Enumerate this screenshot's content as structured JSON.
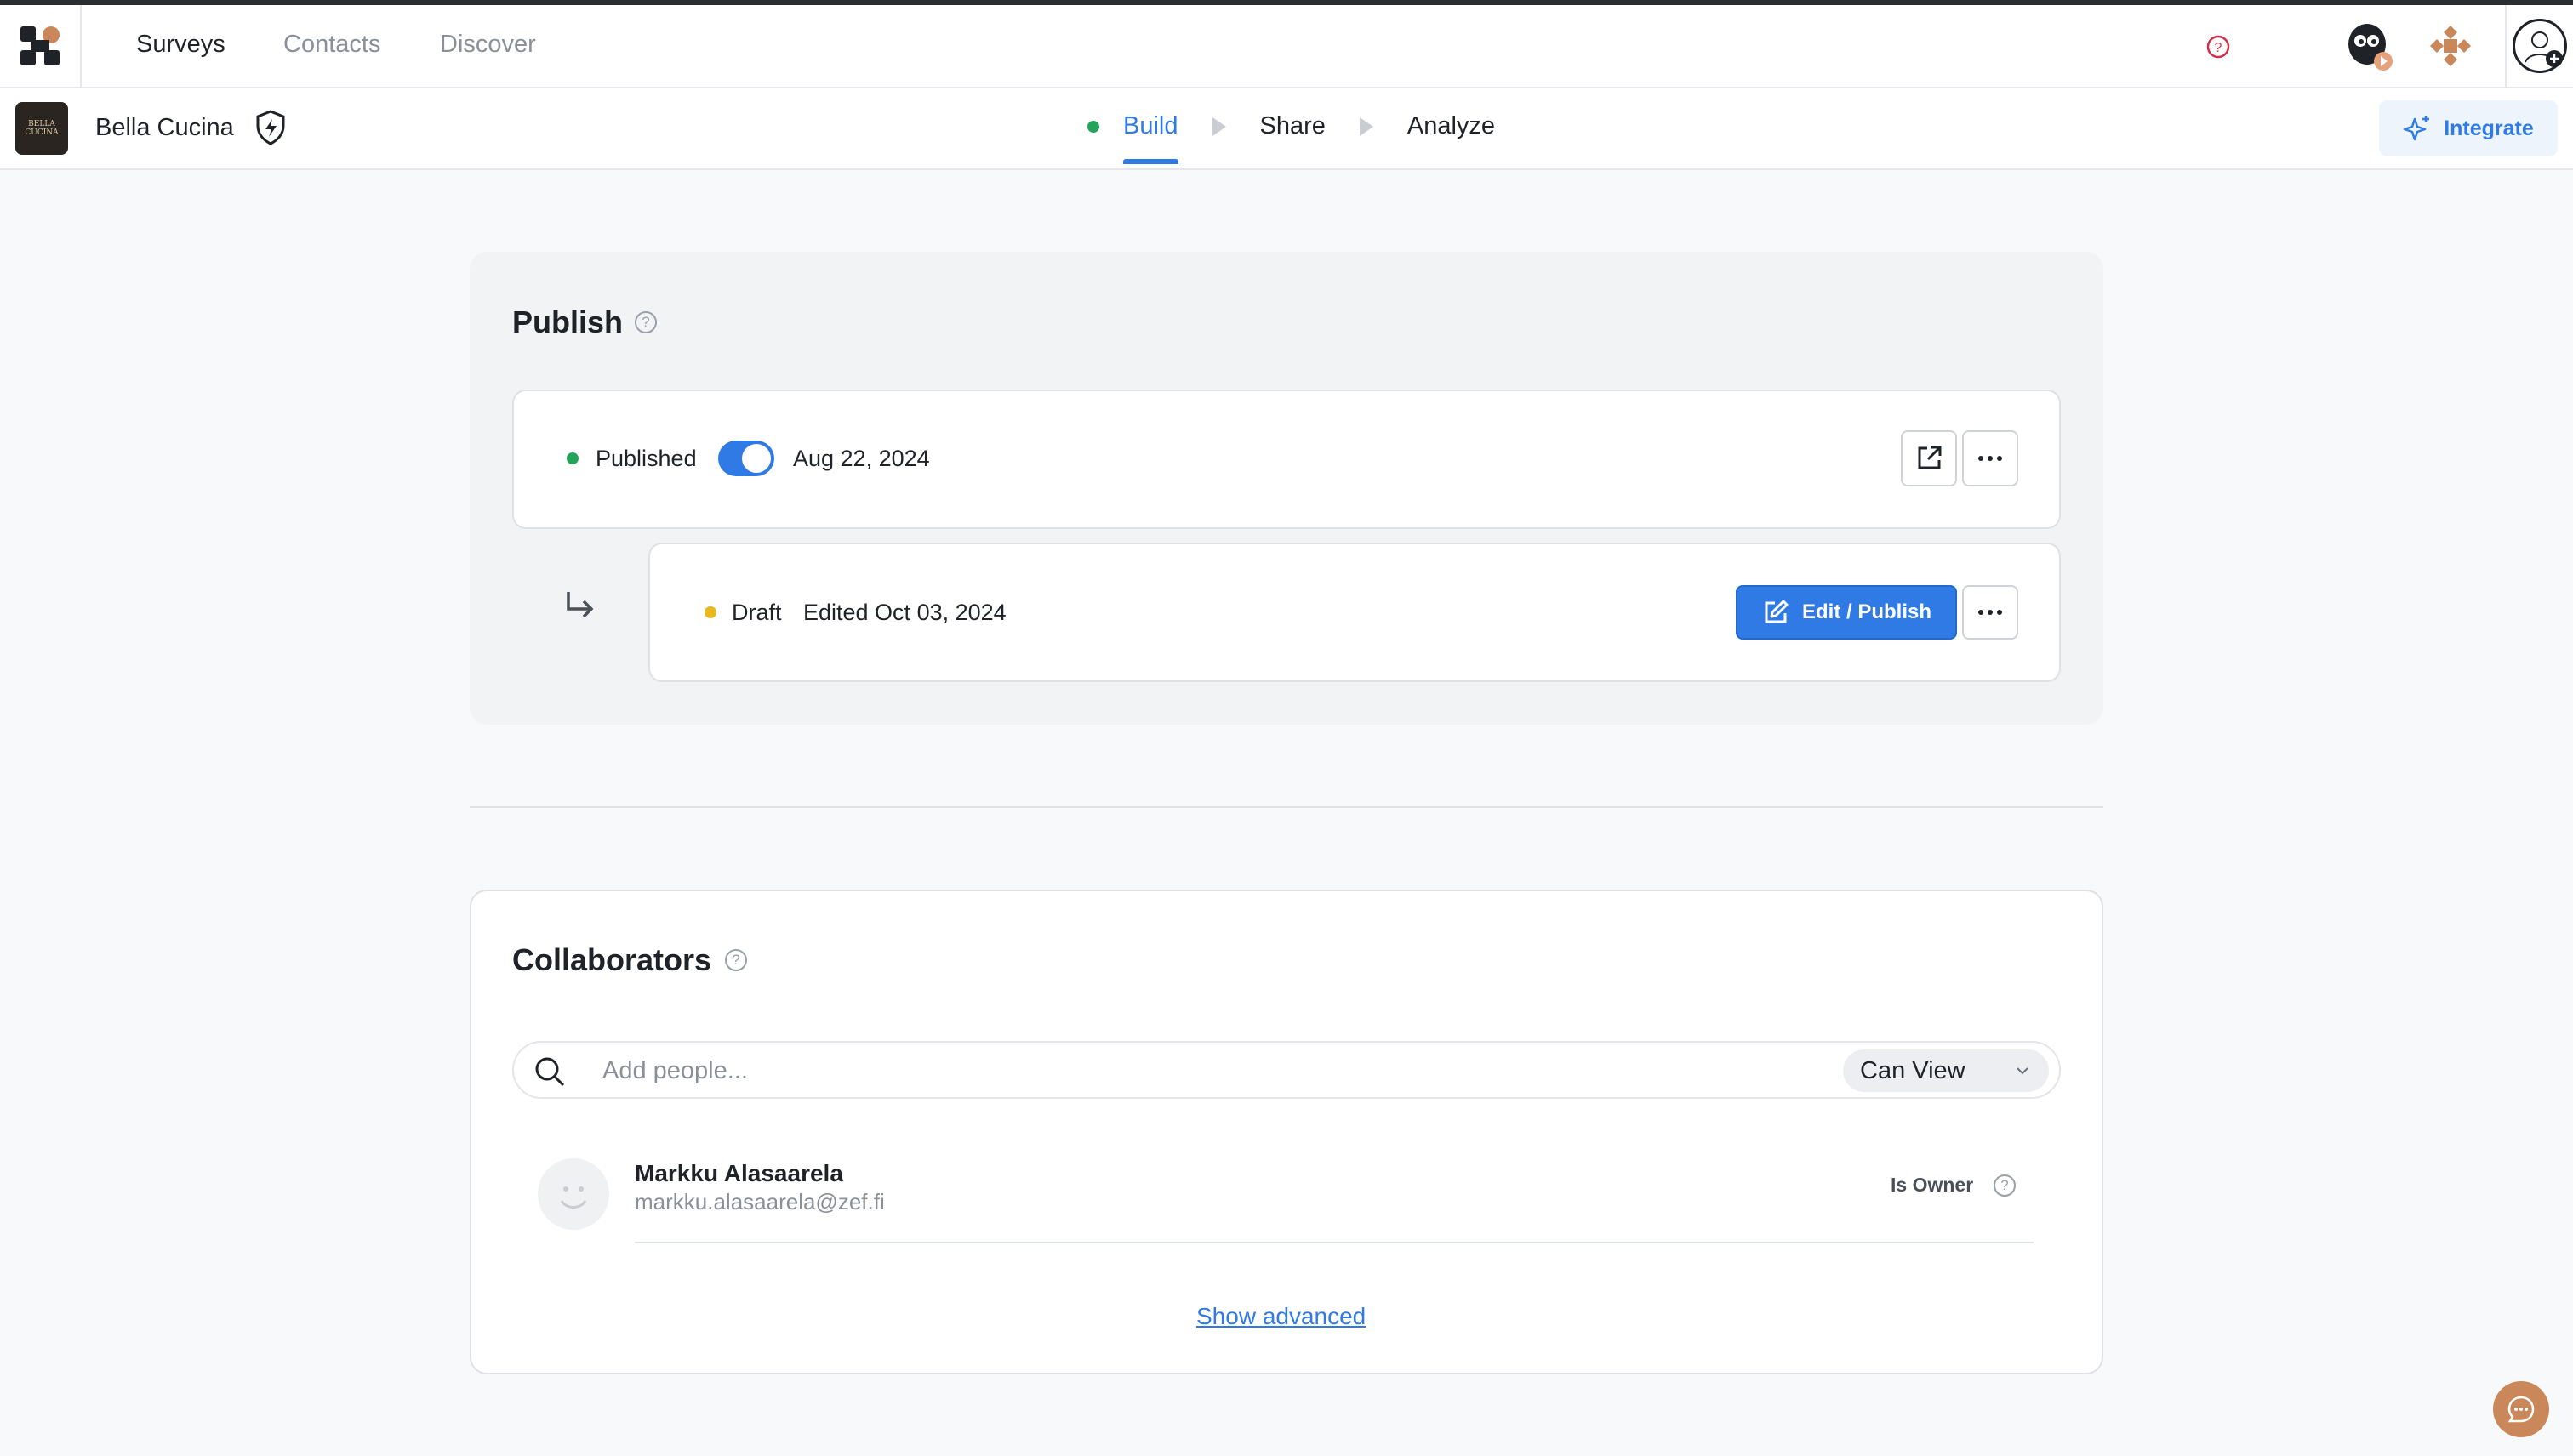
{
  "nav": {
    "items": [
      {
        "label": "Surveys",
        "active": true
      },
      {
        "label": "Contacts",
        "active": false
      },
      {
        "label": "Discover",
        "active": false
      }
    ],
    "icons": [
      "help-icon",
      "ghost-mascot-icon",
      "apps-puzzle-icon",
      "user-avatar-icon"
    ]
  },
  "subbar": {
    "org_name": "Bella Cucina",
    "org_logo_text": "BELLA CUCINA",
    "steps": [
      "Build",
      "Share",
      "Analyze"
    ],
    "active_step": "Build",
    "integrate_label": "Integrate"
  },
  "publish": {
    "title": "Publish",
    "published": {
      "status": "Published",
      "toggle_on": true,
      "date": "Aug 22, 2024"
    },
    "draft": {
      "status": "Draft",
      "edited": "Edited Oct 03, 2024",
      "edit_button_label": "Edit / Publish"
    }
  },
  "collaborators": {
    "title": "Collaborators",
    "search_placeholder": "Add people...",
    "permission_selected": "Can View",
    "users": [
      {
        "name": "Markku Alasaarela",
        "email": "markku.alasaarela@zef.fi",
        "role": "Is Owner"
      }
    ],
    "show_advanced_label": "Show advanced"
  },
  "colors": {
    "accent": "#2f7ae5",
    "published_dot": "#22a45a",
    "draft_dot": "#e8b820",
    "brand_orange": "#c9875a"
  }
}
